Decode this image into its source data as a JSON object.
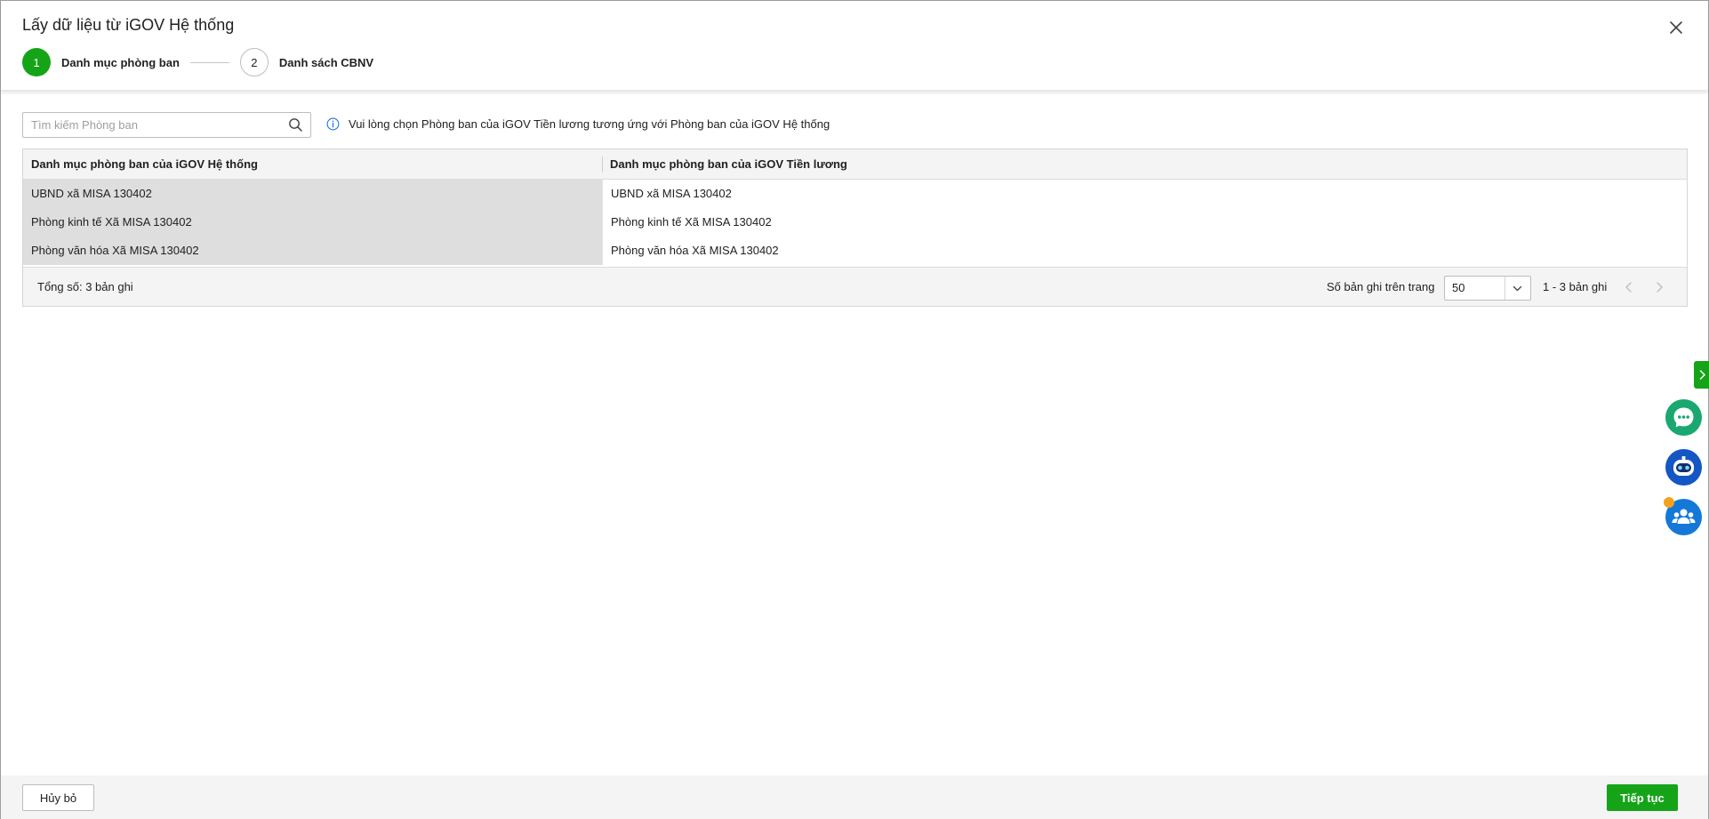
{
  "dialog": {
    "title": "Lấy dữ liệu từ iGOV Hệ thống",
    "close_icon": "close-icon"
  },
  "steps": [
    {
      "number": "1",
      "label": "Danh mục phòng ban",
      "active": true
    },
    {
      "number": "2",
      "label": "Danh sách CBNV",
      "active": false
    }
  ],
  "search": {
    "placeholder": "Tìm kiếm Phòng ban",
    "value": "",
    "icon": "search-icon"
  },
  "info": {
    "icon": "info-icon",
    "text": "Vui lòng chọn Phòng ban của iGOV Tiền lương tương ứng với Phòng ban của iGOV Hệ thống"
  },
  "table": {
    "columns": [
      "Danh mục phòng ban của iGOV Hệ thống",
      "Danh mục phòng ban của iGOV Tiền lương"
    ],
    "rows": [
      [
        "UBND xã MISA 130402",
        "UBND xã MISA 130402"
      ],
      [
        "Phòng kinh tế Xã MISA 130402",
        "Phòng kinh tế Xã MISA 130402"
      ],
      [
        "Phòng văn hóa Xã MISA 130402",
        "Phòng văn hóa Xã MISA 130402"
      ]
    ]
  },
  "pagination": {
    "total": "Tổng số: 3 bản ghi",
    "per_page_label": "Số bản ghi trên trang",
    "per_page_value": "50",
    "range": "1 - 3 bản ghi"
  },
  "footer": {
    "cancel_label": "Hủy bỏ",
    "next_label": "Tiếp tục"
  },
  "colors": {
    "accent": "#15a418",
    "chat_bubble": "#1aa770",
    "bot_bubble": "#1456c4",
    "group_bubble": "#1478d8",
    "notify_dot": "#f4a21c"
  }
}
